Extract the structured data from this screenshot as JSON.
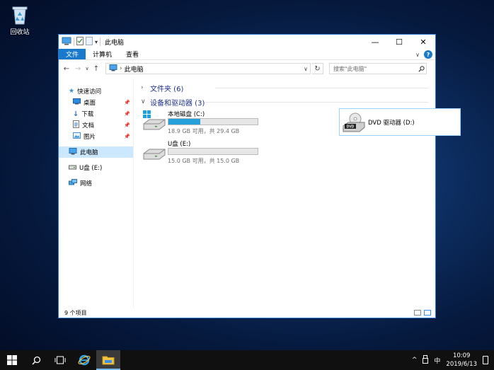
{
  "desktop": {
    "recycle_bin_label": "回收站"
  },
  "window": {
    "title": "此电脑",
    "controls": {
      "minimize": "—",
      "maximize": "☐",
      "close": "✕"
    },
    "ribbon_tabs": [
      "文件",
      "计算机",
      "查看"
    ],
    "address": {
      "path": "此电脑",
      "separator": "›"
    },
    "search_placeholder": "搜索\"此电脑\"",
    "sidebar": {
      "quick_access": "快速访问",
      "pinned": [
        "桌面",
        "下载",
        "文档",
        "图片"
      ],
      "this_pc": "此电脑",
      "usb": "U盘 (E:)",
      "network": "网络"
    },
    "groups": {
      "folders": "文件夹 (6)",
      "devices": "设备和驱动器 (3)"
    },
    "drives": {
      "c": {
        "name": "本地磁盘 (C:)",
        "free_text": "18.9 GB 可用，共 29.4 GB",
        "used_fraction": 0.36
      },
      "e": {
        "name": "U盘 (E:)",
        "free_text": "15.0 GB 可用，共 15.0 GB",
        "used_fraction": 0.0
      },
      "d": {
        "name": "DVD 驱动器 (D:)",
        "badge": "DVD"
      }
    },
    "status": {
      "item_count": "9 个项目"
    }
  },
  "taskbar": {
    "clock_time": "10:09",
    "clock_date": "2019/6/13",
    "ime": "中",
    "tray_chevron": "^"
  },
  "colors": {
    "accent": "#1979ca",
    "selection": "#cce8ff",
    "bar_fill": "#26a0da",
    "group_text": "#1e3287"
  }
}
